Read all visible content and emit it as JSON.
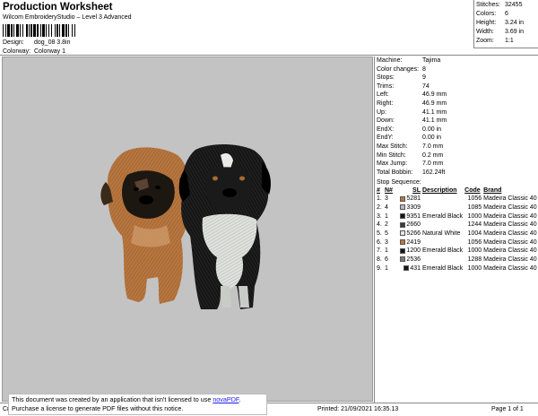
{
  "header": {
    "title": "Production Worksheet",
    "subtitle": "Wilcom EmbroideryStudio – Level 3 Advanced",
    "design_label": "Design:",
    "design_value": "dog_08 3.8in",
    "colorway_label": "Colorway:",
    "colorway_value": "Colorway 1"
  },
  "stats": [
    {
      "label": "Stitches:",
      "value": "32455"
    },
    {
      "label": "Colors:",
      "value": "6"
    },
    {
      "label": "Height:",
      "value": "3.24 in"
    },
    {
      "label": "Width:",
      "value": "3.69 in"
    },
    {
      "label": "Zoom:",
      "value": "1:1"
    }
  ],
  "machine_info": [
    {
      "label": "Machine:",
      "value": "Tajima"
    },
    {
      "label": "Color changes:",
      "value": "8"
    },
    {
      "label": "Stops:",
      "value": "9"
    },
    {
      "label": "Trims:",
      "value": "74"
    },
    {
      "label": "Left:",
      "value": "46.9 mm"
    },
    {
      "label": "Right:",
      "value": "46.9 mm"
    },
    {
      "label": "Up:",
      "value": "41.1 mm"
    },
    {
      "label": "Down:",
      "value": "41.1 mm"
    },
    {
      "label": "EndX:",
      "value": "0.00 in"
    },
    {
      "label": "EndY:",
      "value": "0.00 in"
    },
    {
      "label": "Max Stitch:",
      "value": "7.0 mm"
    },
    {
      "label": "Min Stitch:",
      "value": "0.2 mm"
    },
    {
      "label": "Max Jump:",
      "value": "7.0 mm"
    },
    {
      "label": "Total Bobbin:",
      "value": "162.24ft"
    }
  ],
  "stop_sequence": {
    "label": "Stop Sequence:",
    "headers": {
      "num": "#",
      "n": "N#",
      "sl": "SL",
      "description": "Description",
      "code": "Code",
      "brand": "Brand"
    },
    "rows": [
      {
        "num": "1.",
        "n": "3",
        "color": "#b8763f",
        "sl": "5281",
        "description": "",
        "code": "1056",
        "brand": "Madeira Classic 40"
      },
      {
        "num": "2.",
        "n": "4",
        "color": "#b9b9b9",
        "sl": "3309",
        "description": "",
        "code": "1085",
        "brand": "Madeira Classic 40"
      },
      {
        "num": "3.",
        "n": "1",
        "color": "#151515",
        "sl": "9351",
        "description": "Emerald Black",
        "code": "1000",
        "brand": "Madeira Classic 40"
      },
      {
        "num": "4.",
        "n": "2",
        "color": "#3c3c3c",
        "sl": "2660",
        "description": "",
        "code": "1244",
        "brand": "Madeira Classic 40"
      },
      {
        "num": "5.",
        "n": "5",
        "color": "#e4e6e2",
        "sl": "5266",
        "description": "Natural White",
        "code": "1004",
        "brand": "Madeira Classic 40"
      },
      {
        "num": "6.",
        "n": "3",
        "color": "#b8763f",
        "sl": "2419",
        "description": "",
        "code": "1056",
        "brand": "Madeira Classic 40"
      },
      {
        "num": "7.",
        "n": "1",
        "color": "#151515",
        "sl": "1200",
        "description": "Emerald Black",
        "code": "1000",
        "brand": "Madeira Classic 40"
      },
      {
        "num": "8.",
        "n": "6",
        "color": "#7a7a7a",
        "sl": "2536",
        "description": "",
        "code": "1288",
        "brand": "Madeira Classic 40"
      },
      {
        "num": "9.",
        "n": "1",
        "color": "#151515",
        "sl": "431",
        "description": "Emerald Black",
        "code": "1000",
        "brand": "Madeira Classic 40"
      }
    ]
  },
  "notice": {
    "line1_prefix": "This document was created by an application that isn't licensed to use ",
    "link": "novaPDF",
    "line1_suffix": ".",
    "line2": "Purchase a license to generate PDF files without this notice."
  },
  "footer": {
    "left": "Cr",
    "printed": "Printed: 21/09/2021 16:35.13",
    "page": "Page 1 of 1"
  },
  "colors": {
    "canvas_bg": "#c3c3c3",
    "tan_fur": "#b8763f",
    "black_fur": "#151515",
    "white_fur": "#e4e6e2",
    "link": "#1a1aee"
  }
}
